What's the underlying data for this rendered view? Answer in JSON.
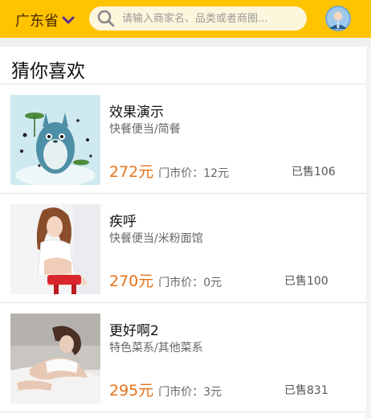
{
  "header": {
    "province": "广东省",
    "search_placeholder": "请输入商家名、品类或者商圈..."
  },
  "section": {
    "title": "猜你喜欢"
  },
  "items": [
    {
      "name": "效果演示",
      "category": "快餐便当/简餐",
      "price": "272元",
      "market_label": "门市价：",
      "market_price": "12元",
      "sold": "已售106"
    },
    {
      "name": "疾呼",
      "category": "快餐便当/米粉面馆",
      "price": "270元",
      "market_label": "门市价：",
      "market_price": "0元",
      "sold": "已售100"
    },
    {
      "name": "更好啊2",
      "category": "特色菜系/其他菜系",
      "price": "295元",
      "market_label": "门市价：",
      "market_price": "3元",
      "sold": "已售831"
    }
  ],
  "colors": {
    "header_bg": "#ffc300",
    "price": "#e5721a"
  },
  "icons": {
    "search": "search-icon",
    "dropdown": "chevron-down-icon",
    "avatar": "user-avatar-icon"
  }
}
